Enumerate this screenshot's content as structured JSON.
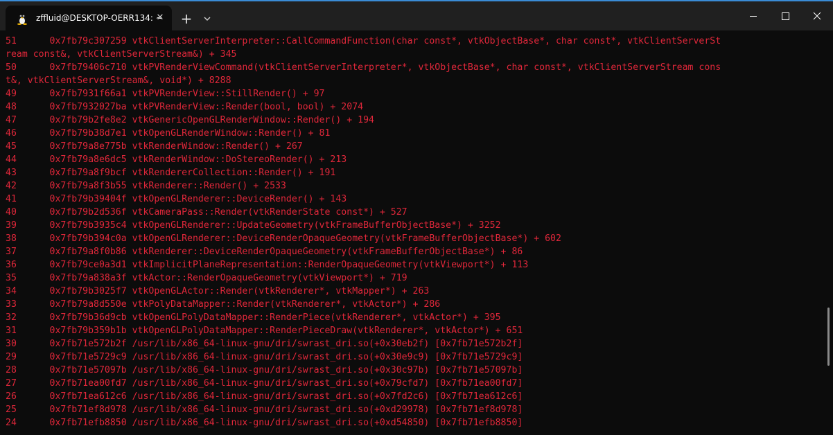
{
  "window": {
    "tab_title": "zffluid@DESKTOP-OERR134: ~",
    "new_tab_symbol": "+",
    "tab_close_symbol": "✕"
  },
  "colors": {
    "terminal_background": "#0c0c0c",
    "titlebar_background": "#202020",
    "text_red": "#e0273a"
  },
  "terminal": {
    "lines": [
      "51      0x7fb79c307259 vtkClientServerInterpreter::CallCommandFunction(char const*, vtkObjectBase*, char const*, vtkClientServerSt",
      "ream const&, vtkClientServerStream&) + 345",
      "50      0x7fb79406c710 vtkPVRenderViewCommand(vtkClientServerInterpreter*, vtkObjectBase*, char const*, vtkClientServerStream cons",
      "t&, vtkClientServerStream&, void*) + 8288",
      "49      0x7fb7931f66a1 vtkPVRenderView::StillRender() + 97",
      "48      0x7fb7932027ba vtkPVRenderView::Render(bool, bool) + 2074",
      "47      0x7fb79b2fe8e2 vtkGenericOpenGLRenderWindow::Render() + 194",
      "46      0x7fb79b38d7e1 vtkOpenGLRenderWindow::Render() + 81",
      "45      0x7fb79a8e775b vtkRenderWindow::Render() + 267",
      "44      0x7fb79a8e6dc5 vtkRenderWindow::DoStereoRender() + 213",
      "43      0x7fb79a8f9bcf vtkRendererCollection::Render() + 191",
      "42      0x7fb79a8f3b55 vtkRenderer::Render() + 2533",
      "41      0x7fb79b39404f vtkOpenGLRenderer::DeviceRender() + 143",
      "40      0x7fb79b2d536f vtkCameraPass::Render(vtkRenderState const*) + 527",
      "39      0x7fb79b3935c4 vtkOpenGLRenderer::UpdateGeometry(vtkFrameBufferObjectBase*) + 3252",
      "38      0x7fb79b394c0a vtkOpenGLRenderer::DeviceRenderOpaqueGeometry(vtkFrameBufferObjectBase*) + 602",
      "37      0x7fb79a8f0b86 vtkRenderer::DeviceRenderOpaqueGeometry(vtkFrameBufferObjectBase*) + 86",
      "36      0x7fb79ce0a3d1 vtkImplicitPlaneRepresentation::RenderOpaqueGeometry(vtkViewport*) + 113",
      "35      0x7fb79a838a3f vtkActor::RenderOpaqueGeometry(vtkViewport*) + 719",
      "34      0x7fb79b3025f7 vtkOpenGLActor::Render(vtkRenderer*, vtkMapper*) + 263",
      "33      0x7fb79a8d550e vtkPolyDataMapper::Render(vtkRenderer*, vtkActor*) + 286",
      "32      0x7fb79b36d9cb vtkOpenGLPolyDataMapper::RenderPiece(vtkRenderer*, vtkActor*) + 395",
      "31      0x7fb79b359b1b vtkOpenGLPolyDataMapper::RenderPieceDraw(vtkRenderer*, vtkActor*) + 651",
      "30      0x7fb71e572b2f /usr/lib/x86_64-linux-gnu/dri/swrast_dri.so(+0x30eb2f) [0x7fb71e572b2f]",
      "29      0x7fb71e5729c9 /usr/lib/x86_64-linux-gnu/dri/swrast_dri.so(+0x30e9c9) [0x7fb71e5729c9]",
      "28      0x7fb71e57097b /usr/lib/x86_64-linux-gnu/dri/swrast_dri.so(+0x30c97b) [0x7fb71e57097b]",
      "27      0x7fb71ea00fd7 /usr/lib/x86_64-linux-gnu/dri/swrast_dri.so(+0x79cfd7) [0x7fb71ea00fd7]",
      "26      0x7fb71ea612c6 /usr/lib/x86_64-linux-gnu/dri/swrast_dri.so(+0x7fd2c6) [0x7fb71ea612c6]",
      "25      0x7fb71ef8d978 /usr/lib/x86_64-linux-gnu/dri/swrast_dri.so(+0xd29978) [0x7fb71ef8d978]",
      "24      0x7fb71efb8850 /usr/lib/x86_64-linux-gnu/dri/swrast_dri.so(+0xd54850) [0x7fb71efb8850]"
    ]
  }
}
